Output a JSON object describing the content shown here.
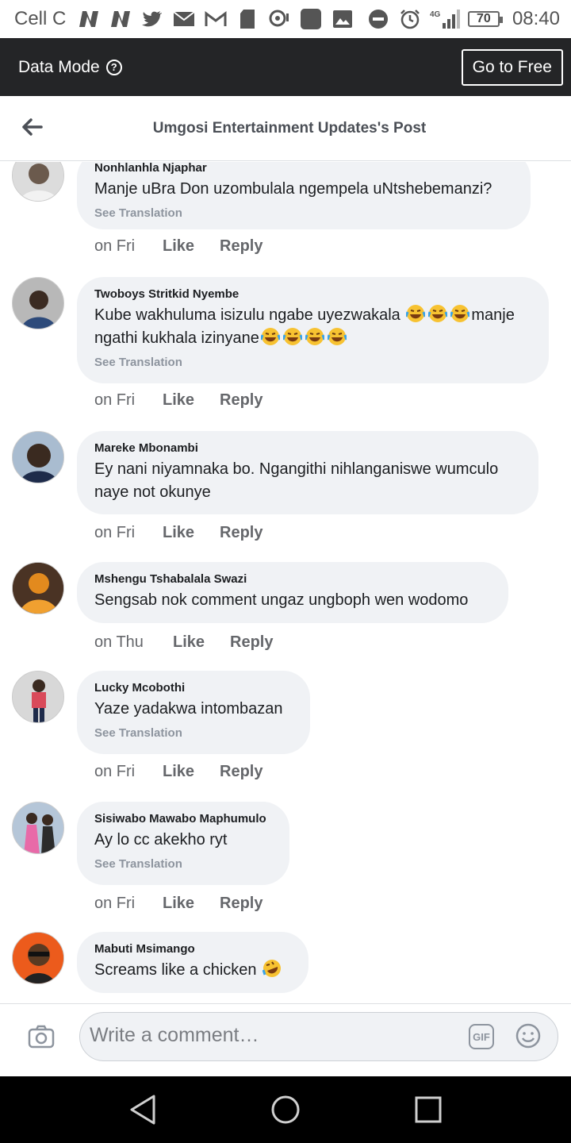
{
  "status_bar": {
    "carrier": "Cell C",
    "network": "4G",
    "battery": "70",
    "time": "08:40"
  },
  "data_mode": {
    "label": "Data Mode",
    "go_free_label": "Go to Free"
  },
  "header": {
    "title": "Umgosi Entertainment Updates's Post"
  },
  "comments": [
    {
      "author": "Nonhlanhla Njaphar",
      "text": "Manje uBra Don uzombulala ngempela uNtshebemanzi?",
      "see_translation": "See Translation",
      "time": "on Fri",
      "like": "Like",
      "reply": "Reply"
    },
    {
      "author": "Twoboys Stritkid Nyembe",
      "text_a": "Kube wakhuluma isizulu ngabe uyezwakala",
      "text_b": "manje ngathi kukhala izinyane",
      "see_translation": "See Translation",
      "time": "on Fri",
      "like": "Like",
      "reply": "Reply"
    },
    {
      "author": "Mareke Mbonambi",
      "text": "Ey nani niyamnaka bo. Ngangithi nihlanganiswe wumculo naye not okunye",
      "time": "on Fri",
      "like": "Like",
      "reply": "Reply"
    },
    {
      "author": "Mshengu Tshabalala Swazi",
      "text": "Sengsab nok comment ungaz ungboph wen wodomo",
      "time": "on Thu",
      "like": "Like",
      "reply": "Reply"
    },
    {
      "author": "Lucky Mcobothi",
      "text": "Yaze yadakwa intombazan",
      "see_translation": "See Translation",
      "time": "on Fri",
      "like": "Like",
      "reply": "Reply"
    },
    {
      "author": "Sisiwabo Mawabo Maphumulo",
      "text": "Ay lo cc akekho ryt",
      "see_translation": "See Translation",
      "time": "on Fri",
      "like": "Like",
      "reply": "Reply"
    },
    {
      "author": "Mabuti Msimango",
      "text": "Screams like a chicken"
    }
  ],
  "composer": {
    "placeholder": "Write a comment…",
    "gif_label": "GIF"
  },
  "colors": {
    "bubble": "#f0f2f5",
    "data_bar": "#242527",
    "meta_text": "#65676b"
  }
}
